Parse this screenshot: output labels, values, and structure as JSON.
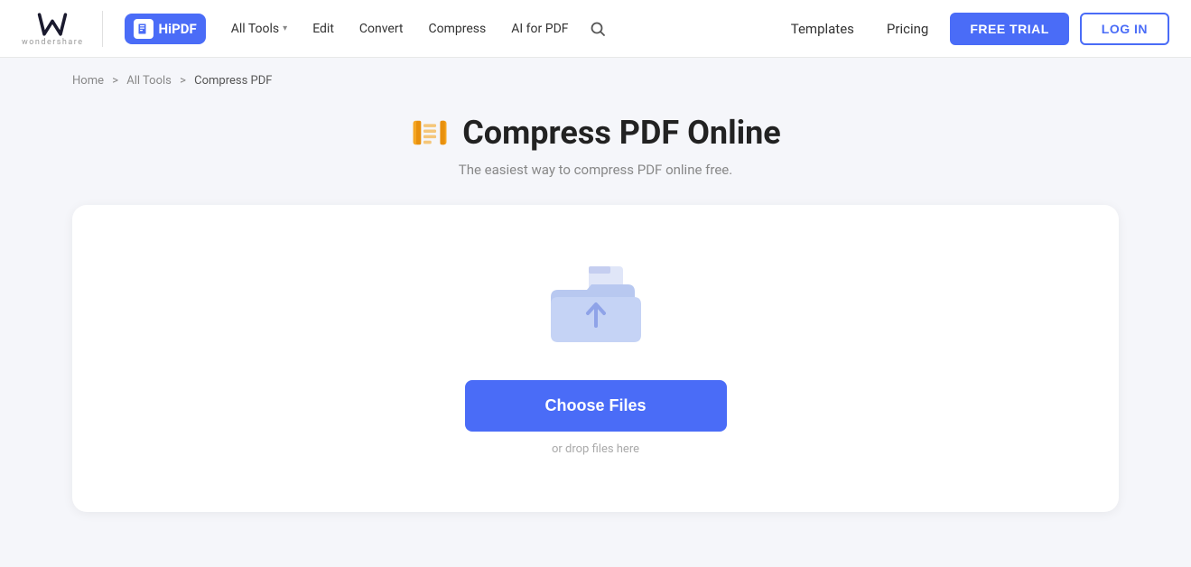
{
  "navbar": {
    "logo_alt": "Wondershare",
    "hipdf_label": "HiPDF",
    "all_tools_label": "All Tools",
    "edit_label": "Edit",
    "convert_label": "Convert",
    "compress_label": "Compress",
    "ai_for_pdf_label": "AI for PDF",
    "templates_label": "Templates",
    "pricing_label": "Pricing",
    "free_trial_label": "FREE TRIAL",
    "login_label": "LOG IN"
  },
  "breadcrumb": {
    "home": "Home",
    "sep1": ">",
    "all_tools": "All Tools",
    "sep2": ">",
    "current": "Compress PDF"
  },
  "page": {
    "title": "Compress PDF Online",
    "subtitle": "The easiest way to compress PDF online free."
  },
  "upload": {
    "choose_files_label": "Choose Files",
    "drop_hint": "or drop files here"
  }
}
